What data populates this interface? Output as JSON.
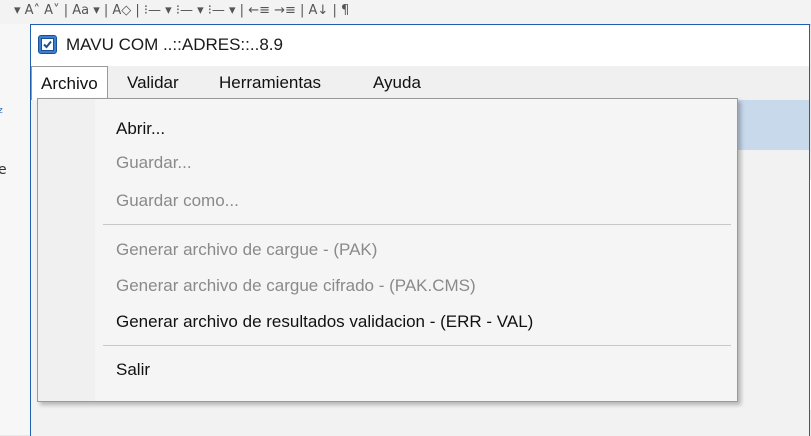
{
  "window": {
    "title": "MAVU COM ..::ADRES::..8.9",
    "icon": "checkbox-app-icon"
  },
  "menubar": {
    "items": [
      {
        "label": "Archivo",
        "active": true
      },
      {
        "label": "Validar",
        "active": false
      },
      {
        "label": "Herramientas",
        "active": false
      },
      {
        "label": "Ayuda",
        "active": false
      }
    ]
  },
  "dropdown": {
    "items": [
      {
        "label": "Abrir...",
        "enabled": true
      },
      {
        "label": "Guardar...",
        "enabled": false
      },
      {
        "label": "Guardar como...",
        "enabled": false
      },
      {
        "label": "Generar archivo de cargue - (PAK)",
        "enabled": false
      },
      {
        "label": "Generar archivo de cargue cifrado - (PAK.CMS)",
        "enabled": false
      },
      {
        "label": "Generar archivo de resultados validacion - (ERR - VAL)",
        "enabled": true
      },
      {
        "label": "Salir",
        "enabled": true
      }
    ]
  },
  "colors": {
    "accent": "#1e5fb1",
    "disabled_text": "#8a8a8a",
    "menu_bg": "#f0f0f0"
  }
}
